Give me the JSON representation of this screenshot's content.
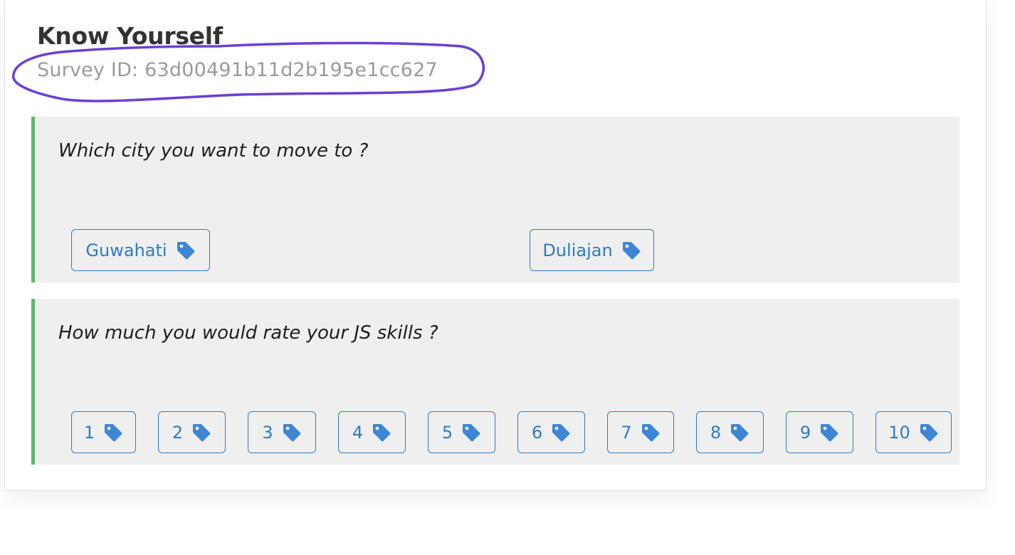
{
  "survey": {
    "title": "Know Yourself",
    "id_text": "Survey ID: 63d00491b11d2b195e1cc627"
  },
  "questions": [
    {
      "text": "Which city you want to move to ?",
      "options": [
        "Guwahati",
        "Duliajan"
      ]
    },
    {
      "text": "How much you would rate your JS skills ?",
      "options": [
        "1",
        "2",
        "3",
        "4",
        "5",
        "6",
        "7",
        "8",
        "9",
        "10"
      ]
    }
  ],
  "icons": {
    "option": "tag-icon"
  },
  "colors": {
    "accent_blue": "#2f7bc4",
    "tag_blue": "#3d86d6",
    "question_border_green": "#5cb876",
    "question_background": "#eeefee",
    "annotation_purple": "#6b3fd4"
  }
}
